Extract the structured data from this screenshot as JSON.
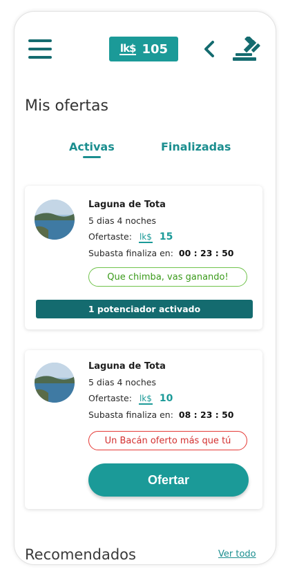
{
  "header": {
    "coins": "105",
    "coin_icon": "lk-coin-icon",
    "menu_icon": "hamburger-menu-icon",
    "back_icon": "chevron-left-icon",
    "auction_icon": "gavel-icon"
  },
  "page": {
    "title": "Mis ofertas"
  },
  "tabs": [
    {
      "label": "Activas",
      "active": true
    },
    {
      "label": "Finalizadas",
      "active": false
    }
  ],
  "offers": [
    {
      "title": "Laguna de Tota",
      "duration": "5 dias 4 noches",
      "offered_label": "Ofertaste:",
      "offered_value": "15",
      "ends_label": "Subasta finaliza en:",
      "ends_time": "00 : 23 : 50",
      "status": "Que chimba, vas ganando!",
      "boost": "1 potenciador activado"
    },
    {
      "title": "Laguna de Tota",
      "duration": "5 dias 4 noches",
      "offered_label": "Ofertaste:",
      "offered_value": "10",
      "ends_label": "Subasta finaliza en:",
      "ends_time": "08 : 23 : 50",
      "status": "Un Bacán oferto más que tú",
      "bid_button": "Ofertar"
    }
  ],
  "recommended": {
    "title": "Recomendados",
    "see_all": "Ver todo"
  },
  "colors": {
    "teal": "#1b9a98",
    "dark_teal": "#146b6f",
    "win_green": "#6fc24a",
    "lose_red": "#e53935"
  }
}
